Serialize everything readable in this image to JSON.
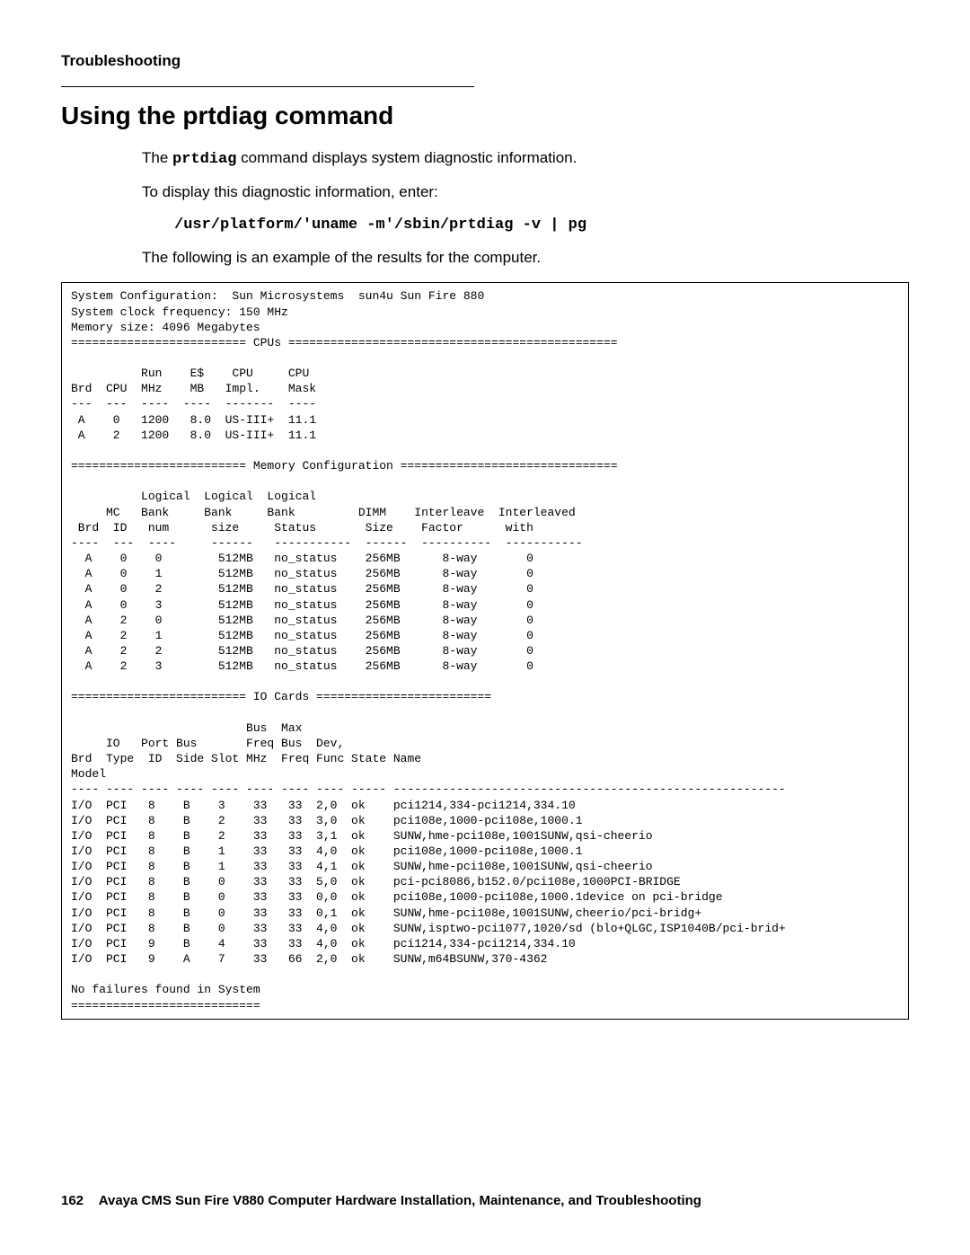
{
  "header": {
    "running": "Troubleshooting"
  },
  "title": "Using the prtdiag command",
  "intro": {
    "p1a": "The ",
    "p1code": "prtdiag",
    "p1b": " command displays system diagnostic information.",
    "p2": "To display this diagnostic information, enter:",
    "cmd": "/usr/platform/'uname -m'/sbin/prtdiag -v | pg",
    "p3": "The following is an example of the results for the computer."
  },
  "code": "System Configuration:  Sun Microsystems  sun4u Sun Fire 880\nSystem clock frequency: 150 MHz\nMemory size: 4096 Megabytes\n========================= CPUs ===============================================\n\n          Run    E$    CPU     CPU\nBrd  CPU  MHz    MB   Impl.    Mask\n---  ---  ----  ----  -------  ----\n A    0   1200   8.0  US-III+  11.1\n A    2   1200   8.0  US-III+  11.1\n\n========================= Memory Configuration ===============================\n\n          Logical  Logical  Logical\n     MC   Bank     Bank     Bank         DIMM    Interleave  Interleaved\n Brd  ID   num      size     Status       Size    Factor      with\n----  ---  ----     ------   -----------  ------  ----------  -----------\n  A    0    0        512MB   no_status    256MB      8-way       0\n  A    0    1        512MB   no_status    256MB      8-way       0\n  A    0    2        512MB   no_status    256MB      8-way       0\n  A    0    3        512MB   no_status    256MB      8-way       0\n  A    2    0        512MB   no_status    256MB      8-way       0\n  A    2    1        512MB   no_status    256MB      8-way       0\n  A    2    2        512MB   no_status    256MB      8-way       0\n  A    2    3        512MB   no_status    256MB      8-way       0\n\n========================= IO Cards =========================\n\n                         Bus  Max\n     IO   Port Bus       Freq Bus  Dev,\nBrd  Type  ID  Side Slot MHz  Freq Func State Name\nModel\n---- ---- ---- ---- ---- ---- ---- ---- ----- --------------------------------------------------------\nI/O  PCI   8    B    3    33   33  2,0  ok    pci1214,334-pci1214,334.10\nI/O  PCI   8    B    2    33   33  3,0  ok    pci108e,1000-pci108e,1000.1\nI/O  PCI   8    B    2    33   33  3,1  ok    SUNW,hme-pci108e,1001SUNW,qsi-cheerio\nI/O  PCI   8    B    1    33   33  4,0  ok    pci108e,1000-pci108e,1000.1\nI/O  PCI   8    B    1    33   33  4,1  ok    SUNW,hme-pci108e,1001SUNW,qsi-cheerio\nI/O  PCI   8    B    0    33   33  5,0  ok    pci-pci8086,b152.0/pci108e,1000PCI-BRIDGE\nI/O  PCI   8    B    0    33   33  0,0  ok    pci108e,1000-pci108e,1000.1device on pci-bridge\nI/O  PCI   8    B    0    33   33  0,1  ok    SUNW,hme-pci108e,1001SUNW,cheerio/pci-bridg+\nI/O  PCI   8    B    0    33   33  4,0  ok    SUNW,isptwo-pci1077,1020/sd (blo+QLGC,ISP1040B/pci-brid+\nI/O  PCI   9    B    4    33   33  4,0  ok    pci1214,334-pci1214,334.10\nI/O  PCI   9    A    7    33   66  2,0  ok    SUNW,m64BSUNW,370-4362\n\nNo failures found in System\n===========================",
  "footer": {
    "page": "162",
    "title": "Avaya CMS Sun Fire V880 Computer Hardware Installation, Maintenance, and Troubleshooting"
  }
}
